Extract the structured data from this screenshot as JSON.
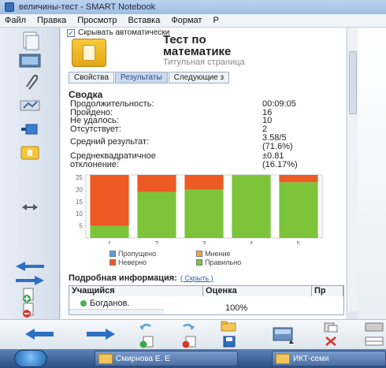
{
  "window": {
    "title": "величины-тест - SMART Notebook"
  },
  "menu": [
    "Файл",
    "Правка",
    "Просмотр",
    "Вставка",
    "Формат",
    "Р"
  ],
  "panel": {
    "hide_auto_label": "Скрывать автоматически",
    "hide_auto_checked": true,
    "test_title_line1": "Тест по",
    "test_title_line2": "математике",
    "test_subtitle": "Титульная страница",
    "tabs": [
      "Свойства",
      "Результаты",
      "Следующие з"
    ],
    "active_tab": "Результаты",
    "summary_heading": "Сводка",
    "stats": [
      {
        "label": "Продолжительность:",
        "value": "00:09:05"
      },
      {
        "label": "Пройдено:",
        "value": "16"
      },
      {
        "label": "Не удалось:",
        "value": "10"
      },
      {
        "label": "Отсутствует:",
        "value": "2"
      },
      {
        "label": "Средний результат:",
        "value": "3.58/5"
      },
      {
        "label": "",
        "value": "(71.6%)"
      },
      {
        "label": "Среднеквадратичное",
        "value": "±0.81"
      },
      {
        "label": "отклонение:",
        "value": "(16.17%)"
      }
    ],
    "legend": {
      "skipped": "Пропущено",
      "opinion": "Мнение",
      "wrong": "Неверно",
      "correct": "Правильно"
    },
    "detail_heading": "Подробная информация:",
    "detail_hide_link": "( Скрыть )",
    "table_headers": [
      "Учащийся",
      "Оценка",
      "Пр"
    ],
    "table_rows": [
      {
        "student": "Богданов.",
        "score": "100%"
      }
    ]
  },
  "colors": {
    "wrong": "#ee5a24",
    "correct": "#7cc43a",
    "opinion": "#f4a640",
    "skipped": "#5aa0d8"
  },
  "chart_data": {
    "type": "bar",
    "stacked": true,
    "categories": [
      "1",
      "2",
      "3",
      "4",
      "5"
    ],
    "series": [
      {
        "name": "Правильно",
        "values": [
          5,
          19,
          20,
          26,
          23
        ]
      },
      {
        "name": "Неверно",
        "values": [
          21,
          7,
          6,
          0,
          3
        ]
      }
    ],
    "ylim": [
      0,
      26
    ],
    "yticks": [
      5,
      10,
      15,
      20,
      25
    ]
  },
  "taskbar": {
    "items": [
      "Смирнова Е. Е",
      "ИКТ-семи"
    ]
  }
}
